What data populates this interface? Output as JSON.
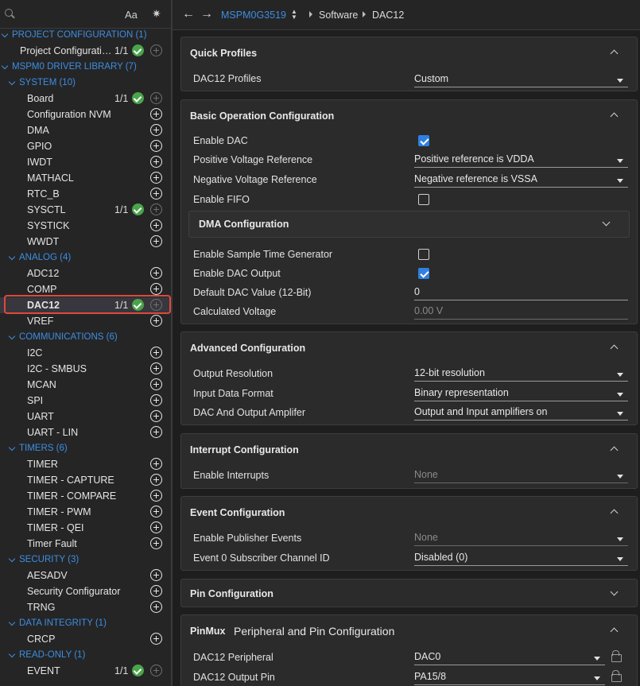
{
  "sidebar": {
    "search_icon": "search-icon",
    "match_case_label": "Aa",
    "filter_icon": "sparkle-icon",
    "tree": [
      {
        "type": "cat",
        "label": "PROJECT CONFIGURATION (1)",
        "indent": 0
      },
      {
        "type": "item",
        "label": "Project Configurati…",
        "count": "1/1",
        "status": "ok"
      },
      {
        "type": "cat",
        "label": "MSPM0 DRIVER LIBRARY (7)",
        "indent": 0
      },
      {
        "type": "cat",
        "label": "SYSTEM (10)",
        "indent": 1
      },
      {
        "type": "item",
        "label": "Board",
        "count": "1/1",
        "status": "ok"
      },
      {
        "type": "item",
        "label": "Configuration NVM"
      },
      {
        "type": "item",
        "label": "DMA"
      },
      {
        "type": "item",
        "label": "GPIO"
      },
      {
        "type": "item",
        "label": "IWDT"
      },
      {
        "type": "item",
        "label": "MATHACL"
      },
      {
        "type": "item",
        "label": "RTC_B"
      },
      {
        "type": "item",
        "label": "SYSCTL",
        "count": "1/1",
        "status": "ok"
      },
      {
        "type": "item",
        "label": "SYSTICK"
      },
      {
        "type": "item",
        "label": "WWDT"
      },
      {
        "type": "cat",
        "label": "ANALOG (4)",
        "indent": 1
      },
      {
        "type": "item",
        "label": "ADC12"
      },
      {
        "type": "item",
        "label": "COMP"
      },
      {
        "type": "item",
        "label": "DAC12",
        "count": "1/1",
        "status": "ok",
        "selected": true
      },
      {
        "type": "item",
        "label": "VREF"
      },
      {
        "type": "cat",
        "label": "COMMUNICATIONS (6)",
        "indent": 1
      },
      {
        "type": "item",
        "label": "I2C"
      },
      {
        "type": "item",
        "label": "I2C - SMBUS"
      },
      {
        "type": "item",
        "label": "MCAN"
      },
      {
        "type": "item",
        "label": "SPI"
      },
      {
        "type": "item",
        "label": "UART"
      },
      {
        "type": "item",
        "label": "UART - LIN"
      },
      {
        "type": "cat",
        "label": "TIMERS (6)",
        "indent": 1
      },
      {
        "type": "item",
        "label": "TIMER"
      },
      {
        "type": "item",
        "label": "TIMER - CAPTURE"
      },
      {
        "type": "item",
        "label": "TIMER - COMPARE"
      },
      {
        "type": "item",
        "label": "TIMER - PWM"
      },
      {
        "type": "item",
        "label": "TIMER - QEI"
      },
      {
        "type": "item",
        "label": "Timer Fault"
      },
      {
        "type": "cat",
        "label": "SECURITY (3)",
        "indent": 1
      },
      {
        "type": "item",
        "label": "AESADV"
      },
      {
        "type": "item",
        "label": "Security Configurator"
      },
      {
        "type": "item",
        "label": "TRNG"
      },
      {
        "type": "cat",
        "label": "DATA INTEGRITY (1)",
        "indent": 1
      },
      {
        "type": "item",
        "label": "CRCP"
      },
      {
        "type": "cat",
        "label": "READ-ONLY (1)",
        "indent": 1
      },
      {
        "type": "item",
        "label": "EVENT",
        "count": "1/1",
        "status": "ok"
      }
    ]
  },
  "topbar": {
    "back_icon": "arrow-left-icon",
    "forward_icon": "arrow-right-icon",
    "device": "MSPM0G3519",
    "crumbs": [
      "Software",
      "DAC12"
    ]
  },
  "panels": {
    "quick_profiles": {
      "title": "Quick Profiles",
      "fields": [
        {
          "label": "DAC12 Profiles",
          "value": "Custom"
        }
      ]
    },
    "basic": {
      "title": "Basic Operation Configuration",
      "enable_dac": {
        "label": "Enable DAC",
        "checked": true
      },
      "pos_ref": {
        "label": "Positive Voltage Reference",
        "value": "Positive reference is VDDA"
      },
      "neg_ref": {
        "label": "Negative Voltage Reference",
        "value": "Negative reference is VSSA"
      },
      "enable_fifo": {
        "label": "Enable FIFO",
        "checked": false
      },
      "dma_title": "DMA Configuration",
      "sample_gen": {
        "label": "Enable Sample Time Generator",
        "checked": false
      },
      "dac_output": {
        "label": "Enable DAC Output",
        "checked": true
      },
      "default_value": {
        "label": "Default DAC Value (12-Bit)",
        "value": "0"
      },
      "calc_voltage": {
        "label": "Calculated Voltage",
        "value": "0.00 V"
      }
    },
    "advanced": {
      "title": "Advanced Configuration",
      "resolution": {
        "label": "Output Resolution",
        "value": "12-bit resolution"
      },
      "format": {
        "label": "Input Data Format",
        "value": "Binary representation"
      },
      "amplifier": {
        "label": "DAC And Output Amplifer",
        "value": "Output and Input amplifiers on"
      }
    },
    "interrupt": {
      "title": "Interrupt Configuration",
      "enable": {
        "label": "Enable Interrupts",
        "value": "None"
      }
    },
    "event": {
      "title": "Event Configuration",
      "publisher": {
        "label": "Enable Publisher Events",
        "value": "None"
      },
      "subscriber": {
        "label": "Event 0 Subscriber Channel ID",
        "value": "Disabled (0)"
      }
    },
    "pin": {
      "title": "Pin Configuration"
    },
    "pinmux": {
      "title": "PinMux",
      "subtitle": "Peripheral and Pin Configuration",
      "peripheral": {
        "label": "DAC12 Peripheral",
        "value": "DAC0"
      },
      "output_pin": {
        "label": "DAC12 Output Pin",
        "value": "PA15/8"
      }
    }
  },
  "colors": {
    "accent": "#3d8ee0",
    "ok": "#4aa44a",
    "highlight": "#e0483c",
    "checkbox": "#2f80e0"
  }
}
